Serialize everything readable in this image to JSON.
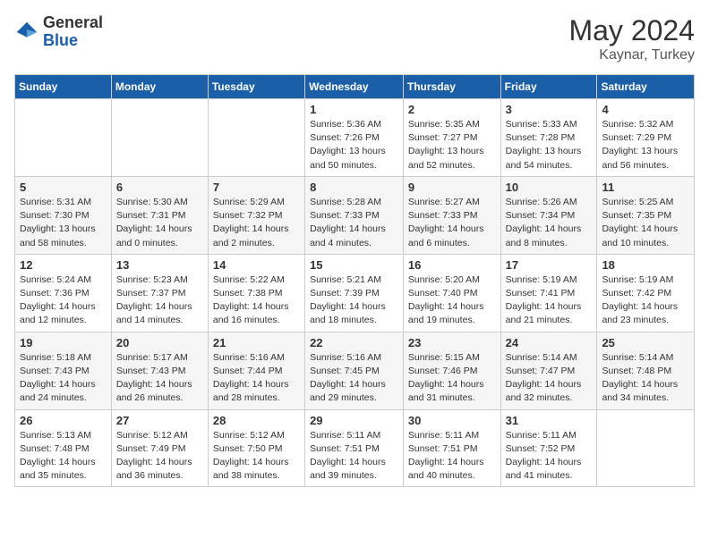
{
  "logo": {
    "general": "General",
    "blue": "Blue"
  },
  "header": {
    "month": "May 2024",
    "location": "Kaynar, Turkey"
  },
  "weekdays": [
    "Sunday",
    "Monday",
    "Tuesday",
    "Wednesday",
    "Thursday",
    "Friday",
    "Saturday"
  ],
  "weeks": [
    [
      {
        "day": "",
        "info": ""
      },
      {
        "day": "",
        "info": ""
      },
      {
        "day": "",
        "info": ""
      },
      {
        "day": "1",
        "info": "Sunrise: 5:36 AM\nSunset: 7:26 PM\nDaylight: 13 hours\nand 50 minutes."
      },
      {
        "day": "2",
        "info": "Sunrise: 5:35 AM\nSunset: 7:27 PM\nDaylight: 13 hours\nand 52 minutes."
      },
      {
        "day": "3",
        "info": "Sunrise: 5:33 AM\nSunset: 7:28 PM\nDaylight: 13 hours\nand 54 minutes."
      },
      {
        "day": "4",
        "info": "Sunrise: 5:32 AM\nSunset: 7:29 PM\nDaylight: 13 hours\nand 56 minutes."
      }
    ],
    [
      {
        "day": "5",
        "info": "Sunrise: 5:31 AM\nSunset: 7:30 PM\nDaylight: 13 hours\nand 58 minutes."
      },
      {
        "day": "6",
        "info": "Sunrise: 5:30 AM\nSunset: 7:31 PM\nDaylight: 14 hours\nand 0 minutes."
      },
      {
        "day": "7",
        "info": "Sunrise: 5:29 AM\nSunset: 7:32 PM\nDaylight: 14 hours\nand 2 minutes."
      },
      {
        "day": "8",
        "info": "Sunrise: 5:28 AM\nSunset: 7:33 PM\nDaylight: 14 hours\nand 4 minutes."
      },
      {
        "day": "9",
        "info": "Sunrise: 5:27 AM\nSunset: 7:33 PM\nDaylight: 14 hours\nand 6 minutes."
      },
      {
        "day": "10",
        "info": "Sunrise: 5:26 AM\nSunset: 7:34 PM\nDaylight: 14 hours\nand 8 minutes."
      },
      {
        "day": "11",
        "info": "Sunrise: 5:25 AM\nSunset: 7:35 PM\nDaylight: 14 hours\nand 10 minutes."
      }
    ],
    [
      {
        "day": "12",
        "info": "Sunrise: 5:24 AM\nSunset: 7:36 PM\nDaylight: 14 hours\nand 12 minutes."
      },
      {
        "day": "13",
        "info": "Sunrise: 5:23 AM\nSunset: 7:37 PM\nDaylight: 14 hours\nand 14 minutes."
      },
      {
        "day": "14",
        "info": "Sunrise: 5:22 AM\nSunset: 7:38 PM\nDaylight: 14 hours\nand 16 minutes."
      },
      {
        "day": "15",
        "info": "Sunrise: 5:21 AM\nSunset: 7:39 PM\nDaylight: 14 hours\nand 18 minutes."
      },
      {
        "day": "16",
        "info": "Sunrise: 5:20 AM\nSunset: 7:40 PM\nDaylight: 14 hours\nand 19 minutes."
      },
      {
        "day": "17",
        "info": "Sunrise: 5:19 AM\nSunset: 7:41 PM\nDaylight: 14 hours\nand 21 minutes."
      },
      {
        "day": "18",
        "info": "Sunrise: 5:19 AM\nSunset: 7:42 PM\nDaylight: 14 hours\nand 23 minutes."
      }
    ],
    [
      {
        "day": "19",
        "info": "Sunrise: 5:18 AM\nSunset: 7:43 PM\nDaylight: 14 hours\nand 24 minutes."
      },
      {
        "day": "20",
        "info": "Sunrise: 5:17 AM\nSunset: 7:43 PM\nDaylight: 14 hours\nand 26 minutes."
      },
      {
        "day": "21",
        "info": "Sunrise: 5:16 AM\nSunset: 7:44 PM\nDaylight: 14 hours\nand 28 minutes."
      },
      {
        "day": "22",
        "info": "Sunrise: 5:16 AM\nSunset: 7:45 PM\nDaylight: 14 hours\nand 29 minutes."
      },
      {
        "day": "23",
        "info": "Sunrise: 5:15 AM\nSunset: 7:46 PM\nDaylight: 14 hours\nand 31 minutes."
      },
      {
        "day": "24",
        "info": "Sunrise: 5:14 AM\nSunset: 7:47 PM\nDaylight: 14 hours\nand 32 minutes."
      },
      {
        "day": "25",
        "info": "Sunrise: 5:14 AM\nSunset: 7:48 PM\nDaylight: 14 hours\nand 34 minutes."
      }
    ],
    [
      {
        "day": "26",
        "info": "Sunrise: 5:13 AM\nSunset: 7:48 PM\nDaylight: 14 hours\nand 35 minutes."
      },
      {
        "day": "27",
        "info": "Sunrise: 5:12 AM\nSunset: 7:49 PM\nDaylight: 14 hours\nand 36 minutes."
      },
      {
        "day": "28",
        "info": "Sunrise: 5:12 AM\nSunset: 7:50 PM\nDaylight: 14 hours\nand 38 minutes."
      },
      {
        "day": "29",
        "info": "Sunrise: 5:11 AM\nSunset: 7:51 PM\nDaylight: 14 hours\nand 39 minutes."
      },
      {
        "day": "30",
        "info": "Sunrise: 5:11 AM\nSunset: 7:51 PM\nDaylight: 14 hours\nand 40 minutes."
      },
      {
        "day": "31",
        "info": "Sunrise: 5:11 AM\nSunset: 7:52 PM\nDaylight: 14 hours\nand 41 minutes."
      },
      {
        "day": "",
        "info": ""
      }
    ]
  ]
}
